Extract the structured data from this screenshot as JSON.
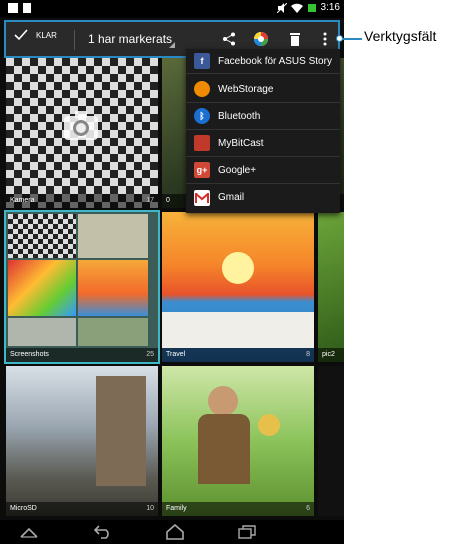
{
  "status": {
    "time": "3:16"
  },
  "toolbar": {
    "done_label": "KLAR",
    "title": "1 har markerats"
  },
  "menu": {
    "items": [
      {
        "label": "Facebook för ASUS Story",
        "icon": "facebook-icon",
        "color": "#3b5998"
      },
      {
        "label": "WebStorage",
        "icon": "webstorage-icon",
        "color": "#f08a00"
      },
      {
        "label": "Bluetooth",
        "icon": "bluetooth-icon",
        "color": "#1a6fd1"
      },
      {
        "label": "MyBitCast",
        "icon": "mybitcast-icon",
        "color": "#c0392b"
      },
      {
        "label": "Google+",
        "icon": "google-plus-icon",
        "color": "#d14836"
      },
      {
        "label": "Gmail",
        "icon": "gmail-icon",
        "color": "#d32f2f"
      }
    ]
  },
  "albums": [
    {
      "name": "Kamera",
      "count": "17"
    },
    {
      "name": "0",
      "count": ""
    },
    {
      "name": "Screenshots",
      "count": "25"
    },
    {
      "name": "Travel",
      "count": "8"
    },
    {
      "name": "pic2",
      "count": ""
    },
    {
      "name": "MicroSD",
      "count": "10"
    },
    {
      "name": "Family",
      "count": "6"
    }
  ],
  "callout": {
    "label": "Verktygsfält"
  },
  "colors": {
    "accent": "#2a8bc2",
    "toolbar_bg": "#2a2a2a",
    "menu_bg": "#1b1b1b"
  }
}
